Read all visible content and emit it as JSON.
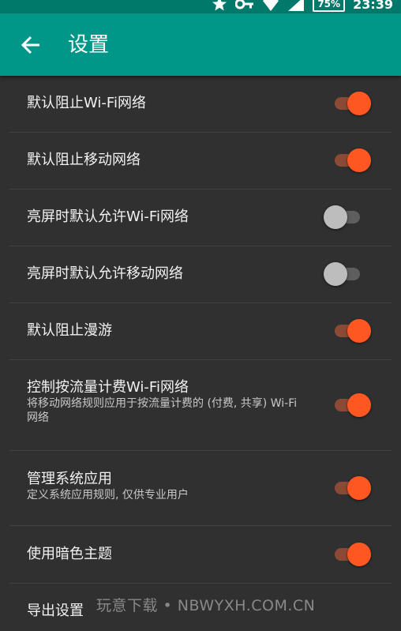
{
  "status_bar": {
    "battery": "75%",
    "time": "23:39"
  },
  "app_bar": {
    "title": "设置"
  },
  "settings": [
    {
      "title": "默认阻止Wi-Fi网络",
      "summary": "",
      "on": true
    },
    {
      "title": "默认阻止移动网络",
      "summary": "",
      "on": true
    },
    {
      "title": "亮屏时默认允许Wi-Fi网络",
      "summary": "",
      "on": false
    },
    {
      "title": "亮屏时默认允许移动网络",
      "summary": "",
      "on": false
    },
    {
      "title": "默认阻止漫游",
      "summary": "",
      "on": true
    },
    {
      "title": "控制按流量计费Wi-Fi网络",
      "summary": "将移动网络规则应用于按流量计费的 (付费, 共享) Wi-Fi网络",
      "on": true
    },
    {
      "title": "管理系统应用",
      "summary": "定义系统应用规则, 仅供专业用户",
      "on": true
    },
    {
      "title": "使用暗色主题",
      "summary": "",
      "on": true
    },
    {
      "title": "导出设置",
      "summary": "",
      "on": null
    }
  ],
  "watermark": "玩意下载 • NBWYXH.COM.CN",
  "colors": {
    "status_bar": "#00796b",
    "app_bar": "#009688",
    "background": "#303030",
    "accent": "#ff5722"
  }
}
